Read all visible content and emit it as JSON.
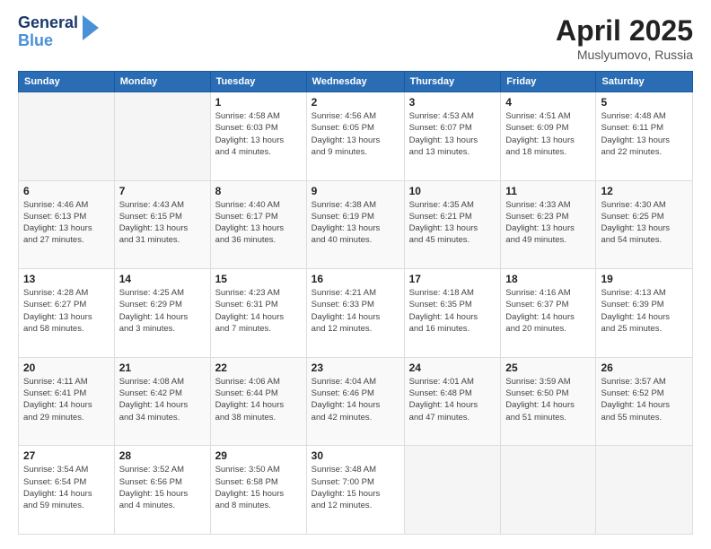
{
  "logo": {
    "line1": "General",
    "line2": "Blue"
  },
  "title": "April 2025",
  "location": "Muslyumovo, Russia",
  "days_header": [
    "Sunday",
    "Monday",
    "Tuesday",
    "Wednesday",
    "Thursday",
    "Friday",
    "Saturday"
  ],
  "weeks": [
    [
      {
        "day": "",
        "info": ""
      },
      {
        "day": "",
        "info": ""
      },
      {
        "day": "1",
        "info": "Sunrise: 4:58 AM\nSunset: 6:03 PM\nDaylight: 13 hours\nand 4 minutes."
      },
      {
        "day": "2",
        "info": "Sunrise: 4:56 AM\nSunset: 6:05 PM\nDaylight: 13 hours\nand 9 minutes."
      },
      {
        "day": "3",
        "info": "Sunrise: 4:53 AM\nSunset: 6:07 PM\nDaylight: 13 hours\nand 13 minutes."
      },
      {
        "day": "4",
        "info": "Sunrise: 4:51 AM\nSunset: 6:09 PM\nDaylight: 13 hours\nand 18 minutes."
      },
      {
        "day": "5",
        "info": "Sunrise: 4:48 AM\nSunset: 6:11 PM\nDaylight: 13 hours\nand 22 minutes."
      }
    ],
    [
      {
        "day": "6",
        "info": "Sunrise: 4:46 AM\nSunset: 6:13 PM\nDaylight: 13 hours\nand 27 minutes."
      },
      {
        "day": "7",
        "info": "Sunrise: 4:43 AM\nSunset: 6:15 PM\nDaylight: 13 hours\nand 31 minutes."
      },
      {
        "day": "8",
        "info": "Sunrise: 4:40 AM\nSunset: 6:17 PM\nDaylight: 13 hours\nand 36 minutes."
      },
      {
        "day": "9",
        "info": "Sunrise: 4:38 AM\nSunset: 6:19 PM\nDaylight: 13 hours\nand 40 minutes."
      },
      {
        "day": "10",
        "info": "Sunrise: 4:35 AM\nSunset: 6:21 PM\nDaylight: 13 hours\nand 45 minutes."
      },
      {
        "day": "11",
        "info": "Sunrise: 4:33 AM\nSunset: 6:23 PM\nDaylight: 13 hours\nand 49 minutes."
      },
      {
        "day": "12",
        "info": "Sunrise: 4:30 AM\nSunset: 6:25 PM\nDaylight: 13 hours\nand 54 minutes."
      }
    ],
    [
      {
        "day": "13",
        "info": "Sunrise: 4:28 AM\nSunset: 6:27 PM\nDaylight: 13 hours\nand 58 minutes."
      },
      {
        "day": "14",
        "info": "Sunrise: 4:25 AM\nSunset: 6:29 PM\nDaylight: 14 hours\nand 3 minutes."
      },
      {
        "day": "15",
        "info": "Sunrise: 4:23 AM\nSunset: 6:31 PM\nDaylight: 14 hours\nand 7 minutes."
      },
      {
        "day": "16",
        "info": "Sunrise: 4:21 AM\nSunset: 6:33 PM\nDaylight: 14 hours\nand 12 minutes."
      },
      {
        "day": "17",
        "info": "Sunrise: 4:18 AM\nSunset: 6:35 PM\nDaylight: 14 hours\nand 16 minutes."
      },
      {
        "day": "18",
        "info": "Sunrise: 4:16 AM\nSunset: 6:37 PM\nDaylight: 14 hours\nand 20 minutes."
      },
      {
        "day": "19",
        "info": "Sunrise: 4:13 AM\nSunset: 6:39 PM\nDaylight: 14 hours\nand 25 minutes."
      }
    ],
    [
      {
        "day": "20",
        "info": "Sunrise: 4:11 AM\nSunset: 6:41 PM\nDaylight: 14 hours\nand 29 minutes."
      },
      {
        "day": "21",
        "info": "Sunrise: 4:08 AM\nSunset: 6:42 PM\nDaylight: 14 hours\nand 34 minutes."
      },
      {
        "day": "22",
        "info": "Sunrise: 4:06 AM\nSunset: 6:44 PM\nDaylight: 14 hours\nand 38 minutes."
      },
      {
        "day": "23",
        "info": "Sunrise: 4:04 AM\nSunset: 6:46 PM\nDaylight: 14 hours\nand 42 minutes."
      },
      {
        "day": "24",
        "info": "Sunrise: 4:01 AM\nSunset: 6:48 PM\nDaylight: 14 hours\nand 47 minutes."
      },
      {
        "day": "25",
        "info": "Sunrise: 3:59 AM\nSunset: 6:50 PM\nDaylight: 14 hours\nand 51 minutes."
      },
      {
        "day": "26",
        "info": "Sunrise: 3:57 AM\nSunset: 6:52 PM\nDaylight: 14 hours\nand 55 minutes."
      }
    ],
    [
      {
        "day": "27",
        "info": "Sunrise: 3:54 AM\nSunset: 6:54 PM\nDaylight: 14 hours\nand 59 minutes."
      },
      {
        "day": "28",
        "info": "Sunrise: 3:52 AM\nSunset: 6:56 PM\nDaylight: 15 hours\nand 4 minutes."
      },
      {
        "day": "29",
        "info": "Sunrise: 3:50 AM\nSunset: 6:58 PM\nDaylight: 15 hours\nand 8 minutes."
      },
      {
        "day": "30",
        "info": "Sunrise: 3:48 AM\nSunset: 7:00 PM\nDaylight: 15 hours\nand 12 minutes."
      },
      {
        "day": "",
        "info": ""
      },
      {
        "day": "",
        "info": ""
      },
      {
        "day": "",
        "info": ""
      }
    ]
  ]
}
